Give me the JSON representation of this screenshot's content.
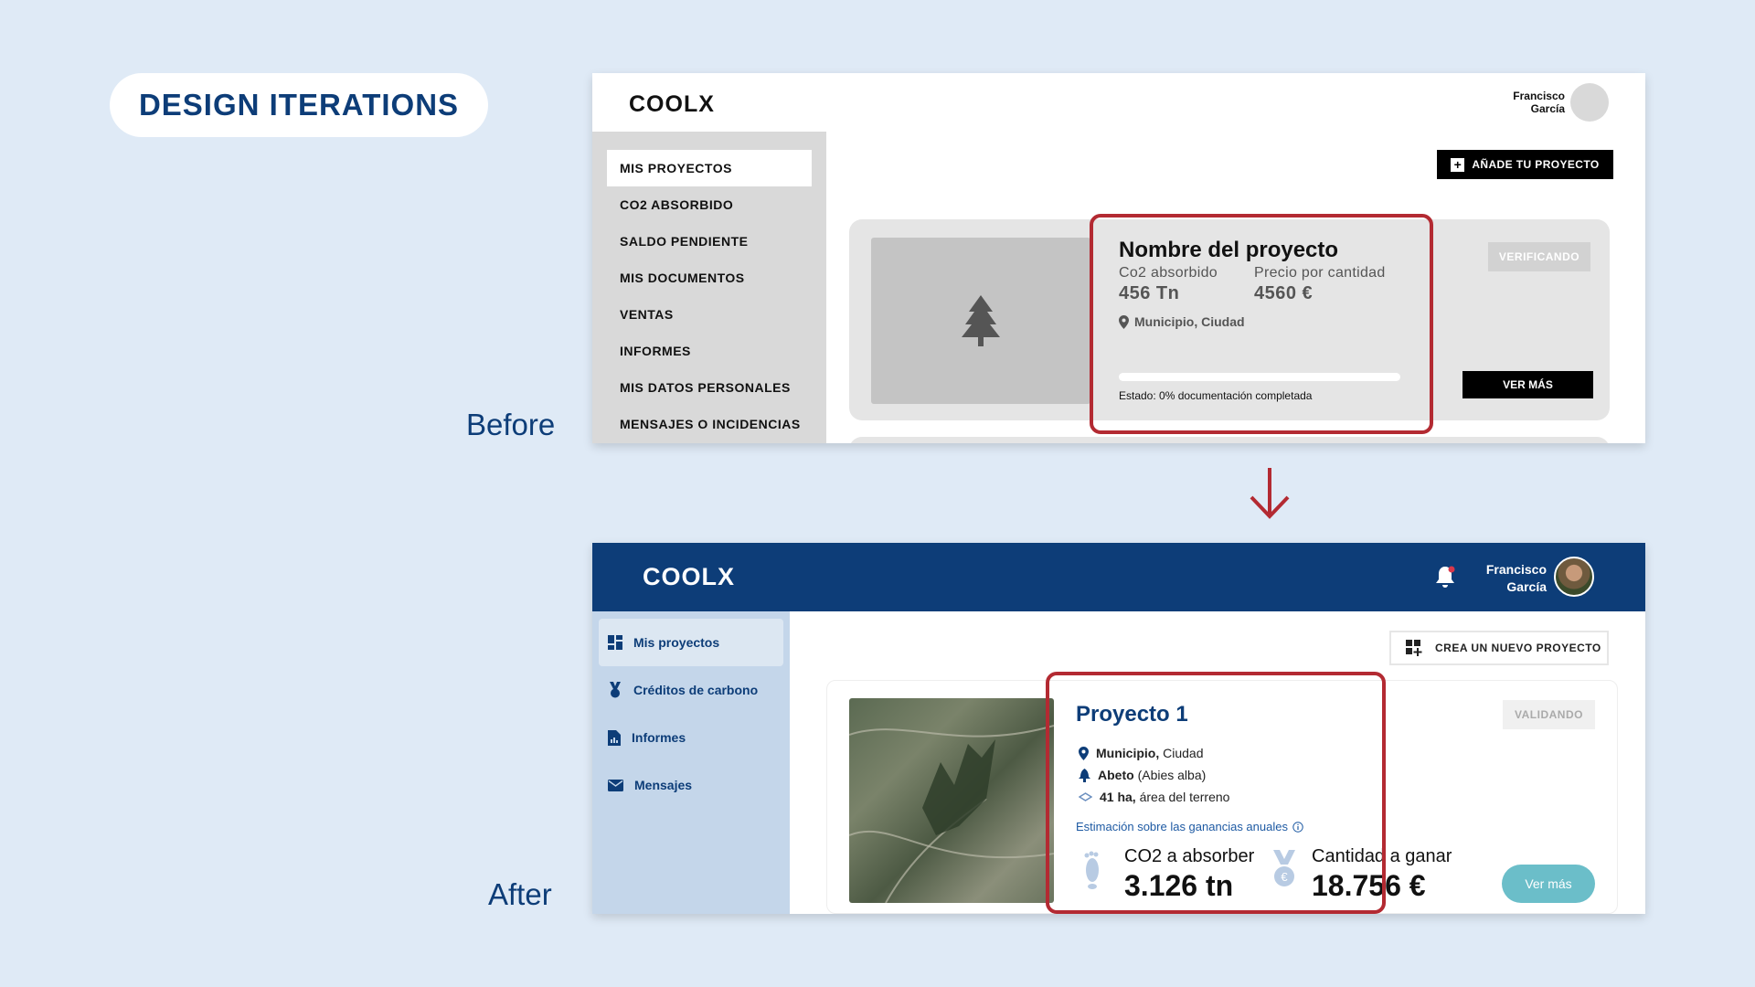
{
  "heading": "DESIGN ITERATIONS",
  "labels": {
    "before": "Before",
    "after": "After"
  },
  "before": {
    "logo": "COOLX",
    "user": {
      "first": "Francisco",
      "last": "García"
    },
    "sidebar": [
      "MIS PROYECTOS",
      "CO2 ABSORBIDO",
      "SALDO PENDIENTE",
      "MIS DOCUMENTOS",
      "VENTAS",
      "INFORMES",
      "MIS DATOS PERSONALES",
      "MENSAJES O INCIDENCIAS"
    ],
    "add_button": "AÑADE TU PROYECTO",
    "card": {
      "title": "Nombre del proyecto",
      "co2_label": "Co2 absorbido",
      "co2_value": "456 Tn",
      "price_label": "Precio por cantidad",
      "price_value": "4560 €",
      "location": "Municipio, Ciudad",
      "status": "Estado: 0% documentación completada",
      "progress": 0,
      "badge": "VERIFICANDO",
      "more": "VER MÁS"
    }
  },
  "after": {
    "logo": "COOLX",
    "user": {
      "first": "Francisco",
      "last": "García"
    },
    "sidebar": [
      {
        "label": "Mis proyectos",
        "icon": "dashboard-icon"
      },
      {
        "label": "Créditos de carbono",
        "icon": "medal-icon"
      },
      {
        "label": "Informes",
        "icon": "document-icon"
      },
      {
        "label": "Mensajes",
        "icon": "mail-icon"
      }
    ],
    "new_button": "CREA UN NUEVO PROYECTO",
    "card": {
      "title": "Proyecto 1",
      "location_bold": "Municipio,",
      "location_rest": "Ciudad",
      "species_bold": "Abeto",
      "species_rest": "(Abies alba)",
      "area_bold": "41 ha,",
      "area_rest": "área del terreno",
      "estimate": "Estimación sobre las ganancias anuales",
      "co2_label": "CO2 a absorber",
      "co2_value": "3.126 tn",
      "gain_label": "Cantidad a ganar",
      "gain_value": "18.756 €",
      "badge": "VALIDANDO",
      "more": "Ver más"
    }
  },
  "colors": {
    "brand": "#0d3d78",
    "highlight": "#b32a32",
    "accent": "#6bbec9",
    "background": "#dfeaf6"
  }
}
